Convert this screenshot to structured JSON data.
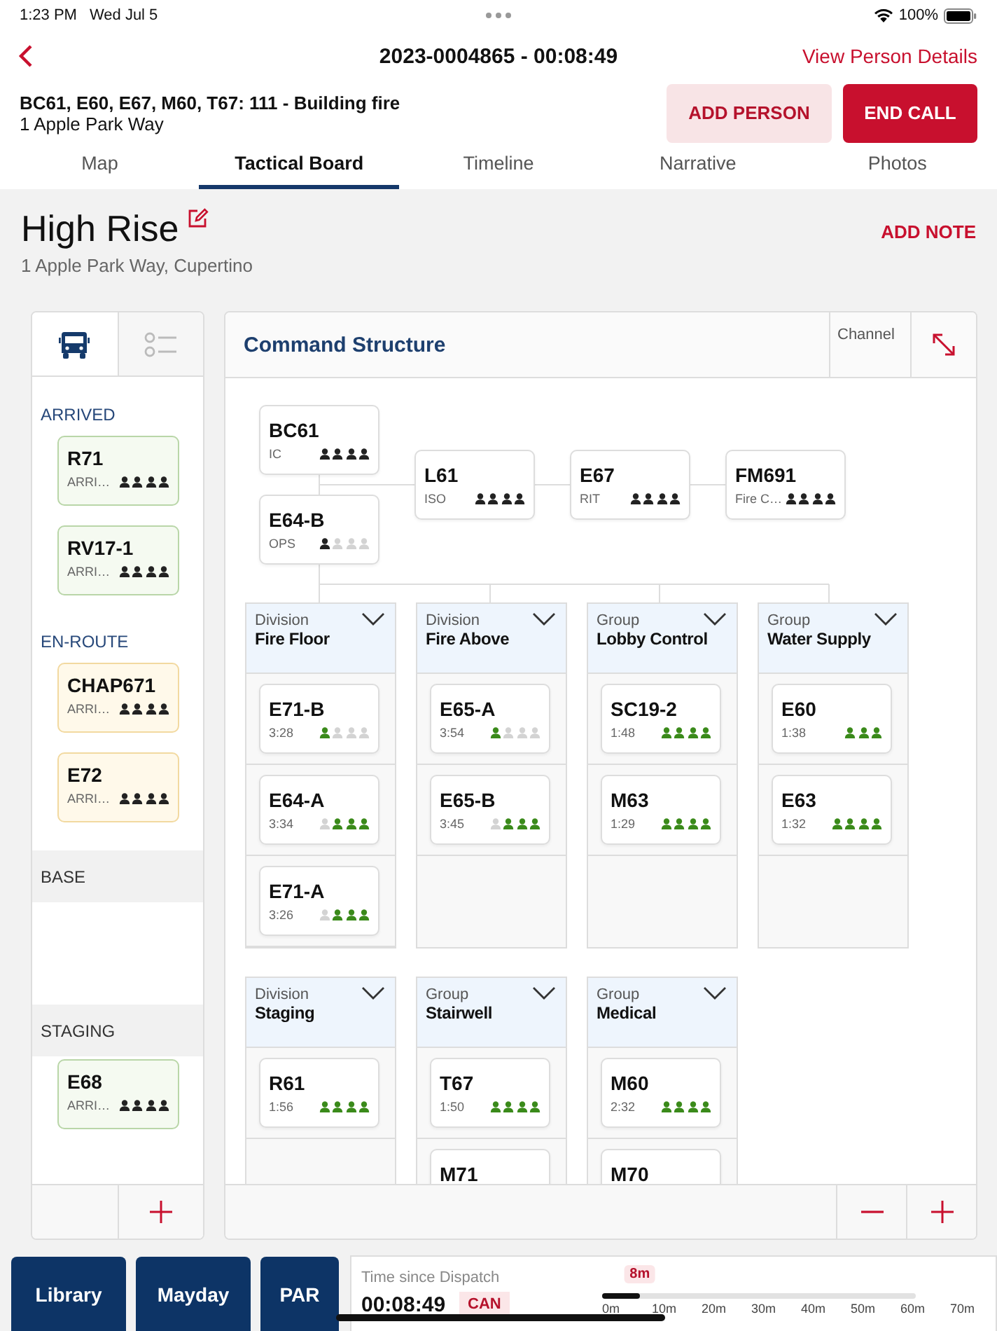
{
  "status_bar": {
    "time": "1:23 PM",
    "date": "Wed Jul 5",
    "battery": "100%"
  },
  "nav": {
    "title": "2023-0004865 - 00:08:49",
    "link": "View Person Details"
  },
  "incident": {
    "units": "BC61, E60, E67, M60, T67: 111 - Building fire",
    "address": "1 Apple Park Way",
    "buttons": [
      {
        "label": "ADD PERSON",
        "kind": "secondary"
      },
      {
        "label": "END CALL",
        "kind": "primary"
      }
    ]
  },
  "tabs": [
    {
      "label": "Map",
      "selected": false
    },
    {
      "label": "Tactical Board",
      "selected": true
    },
    {
      "label": "Timeline",
      "selected": false
    },
    {
      "label": "Narrative",
      "selected": false
    },
    {
      "label": "Photos",
      "selected": false
    }
  ],
  "board": {
    "title": "High Rise",
    "address": "1 Apple Park Way, Cupertino",
    "action": "ADD NOTE"
  },
  "sidebar": {
    "tabs": [
      {
        "kind": "bus",
        "selected": true
      },
      {
        "kind": "checklist",
        "selected": false
      }
    ],
    "sections": [
      {
        "label": "ARRIVED",
        "kind": "status",
        "units": [
          {
            "name": "R71",
            "status": "ARRI…",
            "kind": "arrived",
            "crew": [
              {
                "present": true
              },
              {
                "present": true
              },
              {
                "present": true
              },
              {
                "present": true
              }
            ]
          },
          {
            "name": "RV17-1",
            "status": "ARRI…",
            "kind": "arrived",
            "crew": [
              {
                "present": true
              },
              {
                "present": true
              },
              {
                "present": true
              },
              {
                "present": true
              }
            ]
          }
        ]
      },
      {
        "label": "EN-ROUTE",
        "kind": "status",
        "units": [
          {
            "name": "CHAP671",
            "status": "ARRI…",
            "kind": "enroute",
            "crew": [
              {
                "present": true
              },
              {
                "present": true
              },
              {
                "present": true
              },
              {
                "present": true
              }
            ]
          },
          {
            "name": "E72",
            "status": "ARRI…",
            "kind": "enroute",
            "crew": [
              {
                "present": true
              },
              {
                "present": true
              },
              {
                "present": true
              },
              {
                "present": true
              }
            ]
          }
        ]
      },
      {
        "label": "BASE",
        "kind": "band"
      },
      {
        "label": "STAGING",
        "kind": "band",
        "units": [
          {
            "name": "E68",
            "status": "ARRI…",
            "kind": "arrived",
            "crew": [
              {
                "present": true
              },
              {
                "present": true
              },
              {
                "present": true
              },
              {
                "present": true
              }
            ]
          }
        ]
      }
    ]
  },
  "command": {
    "title": "Command Structure",
    "channel": "Channel",
    "staff": [
      {
        "name": "BC61",
        "role": "IC",
        "crew": [
          {
            "present": true
          },
          {
            "present": true
          },
          {
            "present": true
          },
          {
            "present": true
          }
        ]
      },
      {
        "name": "E64-B",
        "role": "OPS",
        "crew": [
          {
            "present": true
          },
          {
            "present": false
          },
          {
            "present": false
          },
          {
            "present": false
          }
        ]
      },
      {
        "name": "L61",
        "role": "ISO",
        "crew": [
          {
            "present": true
          },
          {
            "present": true
          },
          {
            "present": true
          },
          {
            "present": true
          }
        ]
      },
      {
        "name": "E67",
        "role": "RIT",
        "crew": [
          {
            "present": true
          },
          {
            "present": true
          },
          {
            "present": true
          },
          {
            "present": true
          }
        ]
      },
      {
        "name": "FM691",
        "role": "Fire C…",
        "crew": [
          {
            "present": true
          },
          {
            "present": true
          },
          {
            "present": true
          },
          {
            "present": true
          }
        ]
      }
    ],
    "groups": [
      {
        "type": "Division",
        "name": "Fire Floor",
        "units": [
          {
            "name": "E71-B",
            "time": "3:28",
            "crew": [
              {
                "present": true
              },
              {
                "present": false
              },
              {
                "present": false
              },
              {
                "present": false
              }
            ]
          },
          {
            "name": "E64-A",
            "time": "3:34",
            "crew": [
              {
                "present": false
              },
              {
                "present": true
              },
              {
                "present": true
              },
              {
                "present": true
              }
            ]
          },
          {
            "name": "E71-A",
            "time": "3:26",
            "crew": [
              {
                "present": false
              },
              {
                "present": true
              },
              {
                "present": true
              },
              {
                "present": true
              }
            ]
          }
        ]
      },
      {
        "type": "Division",
        "name": "Fire Above",
        "units": [
          {
            "name": "E65-A",
            "time": "3:54",
            "crew": [
              {
                "present": true
              },
              {
                "present": false
              },
              {
                "present": false
              },
              {
                "present": false
              }
            ]
          },
          {
            "name": "E65-B",
            "time": "3:45",
            "crew": [
              {
                "present": false
              },
              {
                "present": true
              },
              {
                "present": true
              },
              {
                "present": true
              }
            ]
          }
        ]
      },
      {
        "type": "Group",
        "name": "Lobby Control",
        "units": [
          {
            "name": "SC19-2",
            "time": "1:48",
            "crew": [
              {
                "present": true
              },
              {
                "present": true
              },
              {
                "present": true
              },
              {
                "present": true
              }
            ]
          },
          {
            "name": "M63",
            "time": "1:29",
            "crew": [
              {
                "present": true
              },
              {
                "present": true
              },
              {
                "present": true
              },
              {
                "present": true
              }
            ]
          }
        ]
      },
      {
        "type": "Group",
        "name": "Water Supply",
        "units": [
          {
            "name": "E60",
            "time": "1:38",
            "crew": [
              {
                "present": true
              },
              {
                "present": true
              },
              {
                "present": true
              }
            ]
          },
          {
            "name": "E63",
            "time": "1:32",
            "crew": [
              {
                "present": true
              },
              {
                "present": true
              },
              {
                "present": true
              },
              {
                "present": true
              }
            ]
          }
        ]
      },
      {
        "type": "Division",
        "name": "Staging",
        "units": [
          {
            "name": "R61",
            "time": "1:56",
            "crew": [
              {
                "present": true
              },
              {
                "present": true
              },
              {
                "present": true
              },
              {
                "present": true
              }
            ]
          }
        ]
      },
      {
        "type": "Group",
        "name": "Stairwell",
        "units": [
          {
            "name": "T67",
            "time": "1:50",
            "crew": [
              {
                "present": true
              },
              {
                "present": true
              },
              {
                "present": true
              },
              {
                "present": true
              }
            ]
          },
          {
            "name": "M71"
          }
        ]
      },
      {
        "type": "Group",
        "name": "Medical",
        "units": [
          {
            "name": "M60",
            "time": "2:32",
            "crew": [
              {
                "present": true
              },
              {
                "present": true
              },
              {
                "present": true
              },
              {
                "present": true
              }
            ]
          },
          {
            "name": "M70"
          }
        ]
      }
    ]
  },
  "bottom_buttons": [
    "Library",
    "Mayday",
    "PAR"
  ],
  "timer": {
    "label": "Time since Dispatch",
    "elapsed": "00:08:49",
    "badge": "CAN",
    "marker": "8m",
    "level": 0.12,
    "ticks": [
      "0m",
      "10m",
      "20m",
      "30m",
      "40m",
      "50m",
      "60m",
      "70m"
    ]
  }
}
